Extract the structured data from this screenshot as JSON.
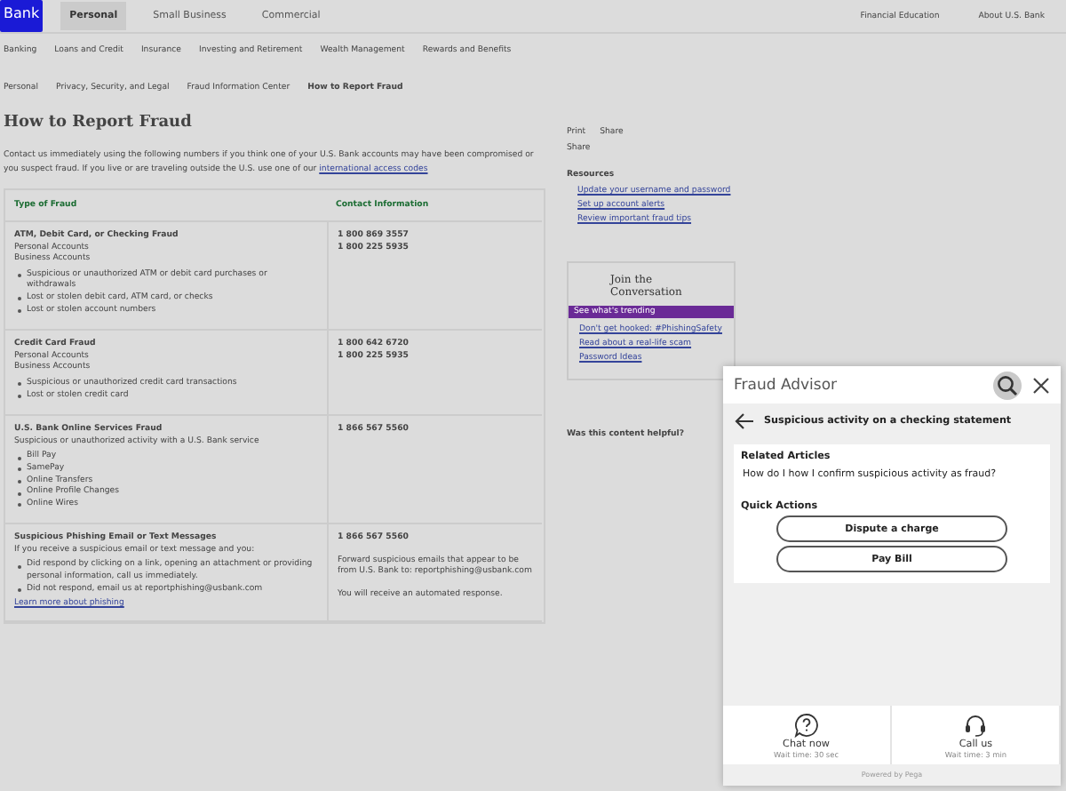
{
  "top_nav": {
    "logo": "Bank",
    "tabs": [
      {
        "label": "Personal",
        "selected": true
      },
      {
        "label": "Small Business",
        "selected": false
      },
      {
        "label": "Commercial",
        "selected": false
      }
    ],
    "links": [
      "Financial Education",
      "About U.S. Bank"
    ]
  },
  "sub_nav": [
    "Banking",
    "Loans and Credit",
    "Insurance",
    "Investing and Retirement",
    "Wealth Management",
    "Rewards and Benefits"
  ],
  "breadcrumbs": [
    "Personal",
    "Privacy, Security, and Legal",
    "Fraud Information Center",
    "How to Report Fraud"
  ],
  "page": {
    "title": "How to Report Fraud",
    "intro": "Contact us immediately using the following numbers if you think one of your U.S. Bank accounts may have been compromised or you suspect fraud. If you live or are traveling outside the U.S. use one of our",
    "intro_link": "international access codes",
    "table": {
      "columns": [
        "Type of Fraud",
        "Contact Information"
      ],
      "rows": [
        {
          "heading": "ATM, Debit Card, or Checking Fraud",
          "lines": [
            "Personal Accounts",
            "Business Accounts"
          ],
          "bullets": [
            "Suspicious or unauthorized ATM or debit card purchases or withdrawals",
            "Lost or stolen debit card, ATM card, or checks",
            "Lost or stolen account numbers"
          ],
          "contact": [
            "1 800 869 3557",
            "1 800 225 5935"
          ]
        },
        {
          "heading": "Credit Card Fraud",
          "lines": [
            "Personal Accounts",
            "Business Accounts"
          ],
          "bullets": [
            "Suspicious or unauthorized credit card transactions",
            "Lost or stolen credit card"
          ],
          "contact": [
            "1 800 642 6720",
            "1 800 225 5935"
          ]
        },
        {
          "heading": "U.S. Bank Online Services Fraud",
          "lines": [
            "Suspicious or unauthorized activity with a U.S. Bank service"
          ],
          "bullets": [
            "Bill Pay",
            "SamePay",
            "Online Transfers",
            "Online Profile Changes",
            "Online Wires"
          ],
          "contact": [
            "1 866 567 5560"
          ]
        },
        {
          "heading": "Suspicious Phishing Email or Text Messages",
          "lines": [
            "If you receive a suspicious email or text message and you:"
          ],
          "bullets": [
            "Did respond by clicking on a link, opening an attachment or providing personal information, call us immediately.",
            "Did not respond, email us at reportphishing@usbank.com"
          ],
          "link": "Learn more about phishing",
          "contact": [
            "1 866 567 5560"
          ],
          "contact_note": "Forward suspicious emails that appear to be from U.S. Bank to: reportphishing@usbank.com",
          "contact_note2": "You will receive an automated response."
        }
      ]
    }
  },
  "sidebar": {
    "share": [
      "Print",
      "Share",
      "Share"
    ],
    "resources_title": "Resources",
    "resources": [
      "Update your username and password",
      "Set up account alerts",
      "Review important fraud tips"
    ],
    "conversation_title": "Join the Conversation",
    "conversation_tab": "See what's trending",
    "conversation_links": [
      "Don't get hooked: #PhishingSafety",
      "Read about a real-life scam",
      "Password Ideas"
    ],
    "helpful": "Was this content helpful?"
  },
  "advisor": {
    "title": "Fraud Advisor",
    "topic": "Suspicious activity on a checking statement",
    "related_title": "Related Articles",
    "related": [
      "How do I how I confirm suspicious activity as fraud?"
    ],
    "actions_title": "Quick Actions",
    "actions": [
      "Dispute a charge",
      "Pay Bill"
    ],
    "contact": [
      {
        "kind": "chat",
        "label": "Chat now",
        "wait": "Wait time: 30 sec"
      },
      {
        "kind": "call",
        "label": "Call us",
        "wait": "Wait time: 3 min"
      }
    ],
    "footer": "Powered by Pega"
  }
}
